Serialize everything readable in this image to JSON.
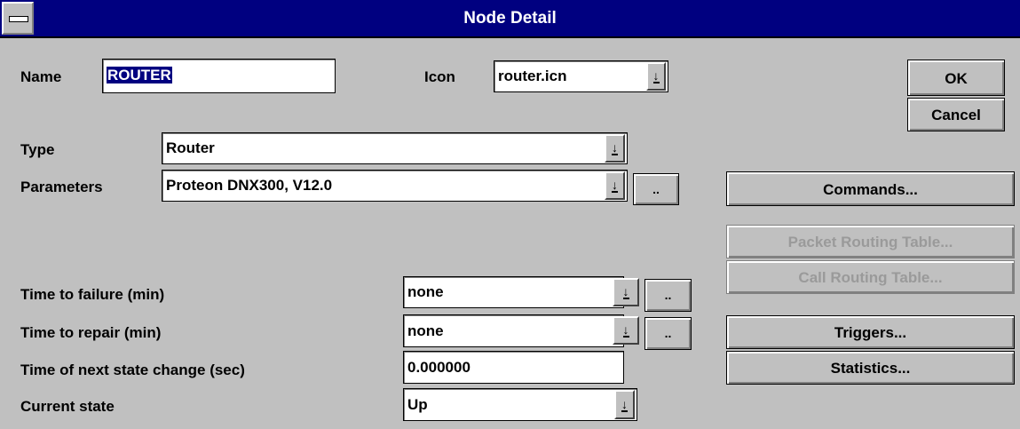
{
  "window": {
    "title": "Node Detail"
  },
  "name": {
    "label": "Name",
    "value": "ROUTER"
  },
  "icon": {
    "label": "Icon",
    "value": "router.icn"
  },
  "type": {
    "label": "Type",
    "value": "Router"
  },
  "parameters": {
    "label": "Parameters",
    "value": "Proteon DNX300, V12.0",
    "more_label": ".."
  },
  "time_to_failure": {
    "label": "Time to failure (min)",
    "value": "none",
    "more_label": ".."
  },
  "time_to_repair": {
    "label": "Time to repair (min)",
    "value": "none",
    "more_label": ".."
  },
  "next_state_change": {
    "label": "Time of next state change (sec)",
    "value": "0.000000"
  },
  "current_state": {
    "label": "Current state",
    "value": "Up"
  },
  "buttons": {
    "ok": "OK",
    "cancel": "Cancel",
    "commands": "Commands...",
    "packet_routing": "Packet Routing Table...",
    "call_routing": "Call Routing Table...",
    "triggers": "Triggers...",
    "statistics": "Statistics..."
  },
  "icons": {
    "dropdown": "dropdown-arrow-icon",
    "system_menu": "system-menu-icon"
  }
}
